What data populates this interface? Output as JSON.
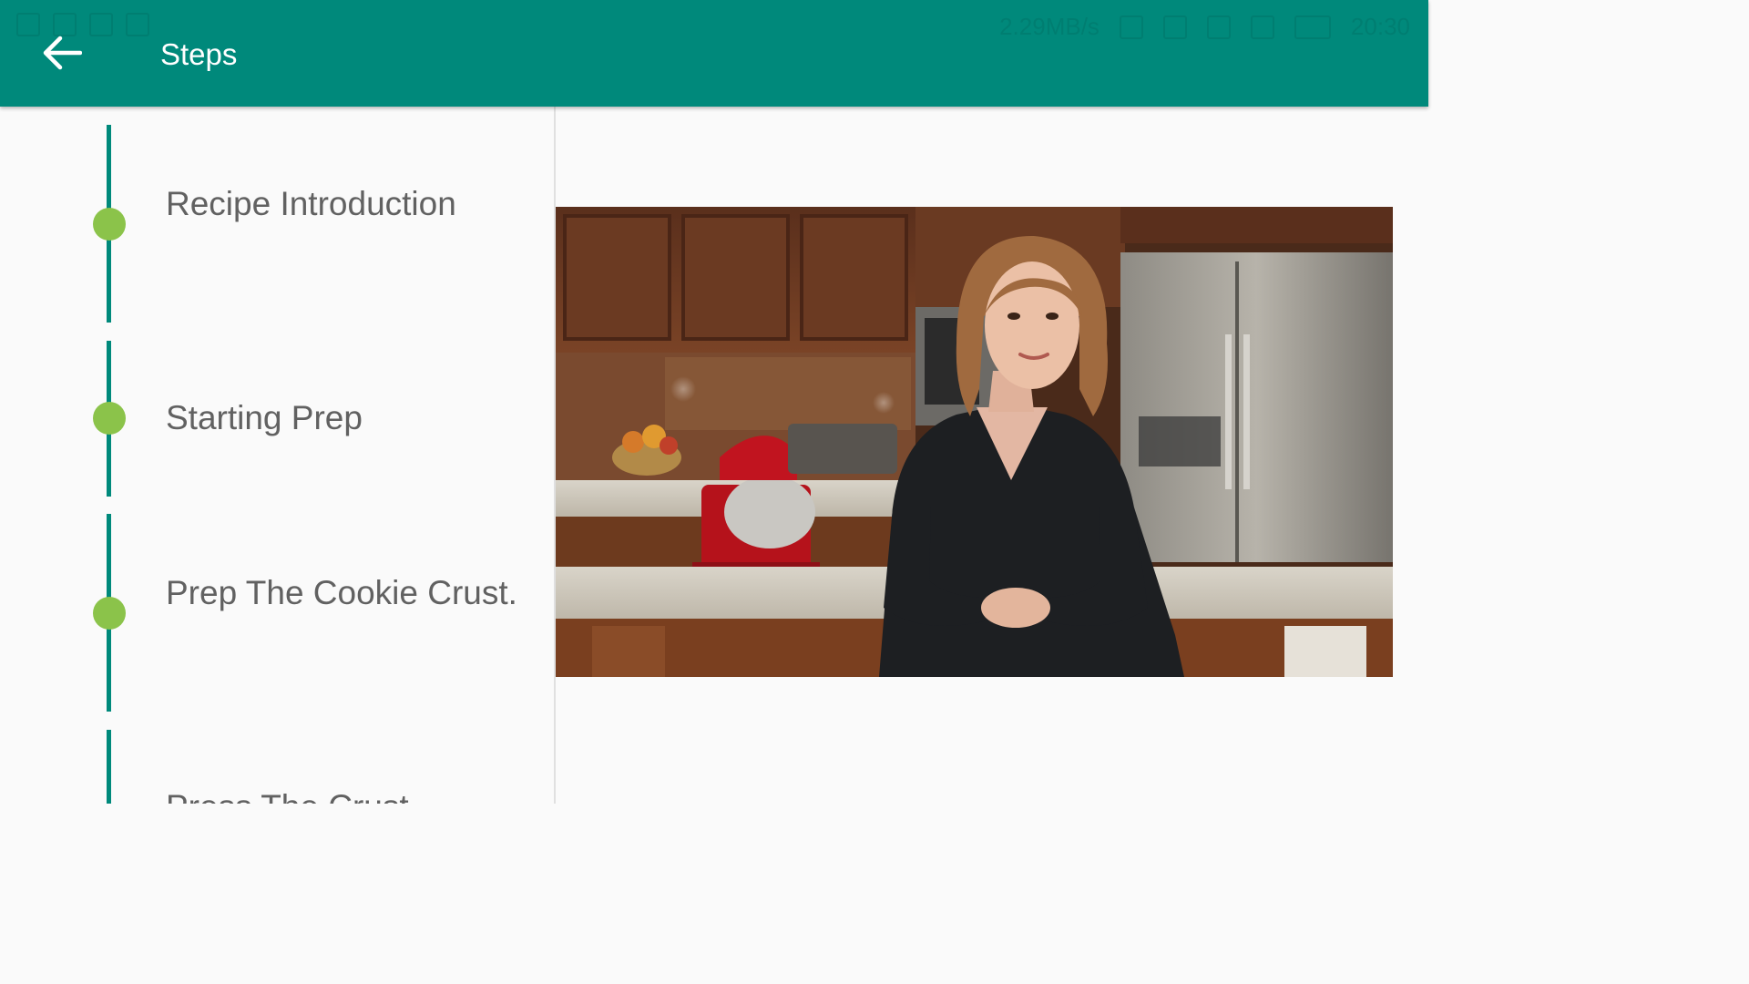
{
  "appbar": {
    "title": "Steps",
    "back_icon": "arrow-left-icon",
    "color": "#00897b"
  },
  "statusbar": {
    "network_speed": "2.29MB/s",
    "time": "20:30"
  },
  "steps": [
    {
      "label": "Recipe Introduction",
      "active": false
    },
    {
      "label": "Starting Prep",
      "active": false
    },
    {
      "label": "Prep The Cookie Crust.",
      "active": false
    },
    {
      "label": "Press The Crust",
      "active": false
    }
  ],
  "colors": {
    "accent": "#00897b",
    "dot": "#8bc34a",
    "text": "#616161"
  }
}
